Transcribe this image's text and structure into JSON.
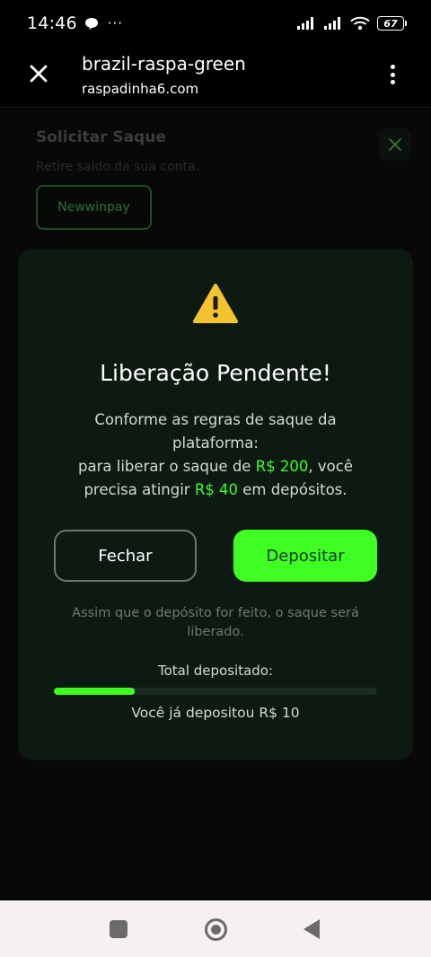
{
  "status_bar": {
    "time": "14:46",
    "dots": "···",
    "battery": "67"
  },
  "browser": {
    "title": "brazil-raspa-green",
    "host": "raspadinha6.com"
  },
  "page": {
    "title": "Solicitar Saque",
    "subtitle": "Retire saldo da sua conta.",
    "method_chip": "Newwinpay"
  },
  "modal": {
    "title": "Liberação Pendente!",
    "line1": "Conforme as regras de saque da plataforma:",
    "line2_prefix": "para liberar o saque de ",
    "release_amount": "R$ 200",
    "line2_suffix": ", você precisa atingir ",
    "deposit_target": "R$ 40",
    "line3_suffix": " em depósitos.",
    "close_label": "Fechar",
    "deposit_label": "Depositar",
    "note": "Assim que o depósito for feito, o saque será liberado.",
    "total_label": "Total depositado:",
    "progress_fraction": 0.25,
    "progress_text": "Você já depositou R$ 10"
  },
  "colors": {
    "accent": "#3fff22",
    "modal_bg": "#0d1a12",
    "warning": "#f4c430"
  },
  "icons": {
    "close": "close-icon",
    "menu": "more-vert-icon",
    "warning": "warning-triangle-icon"
  }
}
